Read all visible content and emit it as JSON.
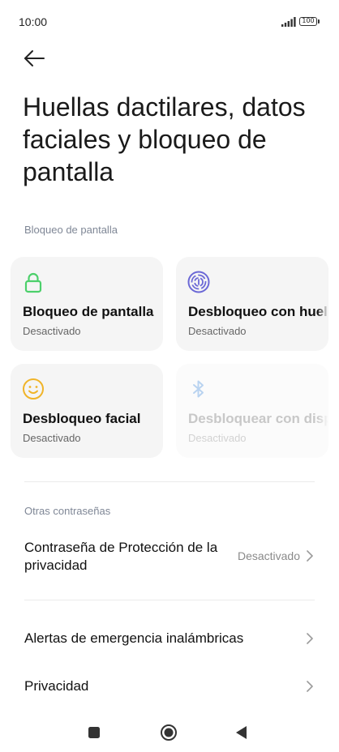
{
  "status_bar": {
    "time": "10:00",
    "battery": "100",
    "signal_icon": "cellular-signal-icon",
    "battery_icon": "battery-icon"
  },
  "header": {
    "back_icon": "back-arrow-icon",
    "title": "Huellas dactilares, datos faciales y bloqueo de pantalla"
  },
  "screen_lock_section": {
    "label": "Bloqueo de pantalla",
    "cards": [
      {
        "title": "Bloqueo de pantalla",
        "status": "Desactivado",
        "icon": "lock-icon",
        "icon_color": "#4cd06b"
      },
      {
        "title": "Desbloqueo con huella",
        "status": "Desactivado",
        "icon": "fingerprint-icon",
        "icon_color": "#6b68d6"
      },
      {
        "title": "Desbloqueo facial",
        "status": "Desactivado",
        "icon": "face-icon",
        "icon_color": "#f0b429"
      },
      {
        "title": "Desbloquear con dispositivo",
        "status": "Desactivado",
        "icon": "bluetooth-icon",
        "icon_color": "#b9d3f0",
        "disabled": true
      }
    ]
  },
  "other_passwords_section": {
    "label": "Otras contraseñas",
    "privacy_password": {
      "title": "Contraseña de Protección de la privacidad",
      "value": "Desactivado"
    }
  },
  "rows": [
    {
      "title": "Alertas de emergencia inalámbricas"
    },
    {
      "title": "Privacidad"
    }
  ],
  "nav_bar": {
    "recents_icon": "square-recents-icon",
    "home_icon": "circle-home-icon",
    "back_icon": "triangle-back-icon"
  },
  "colors": {
    "card_background": "#f5f5f5",
    "section_label": "#7f8796",
    "chevron": "#9a9a9a"
  }
}
